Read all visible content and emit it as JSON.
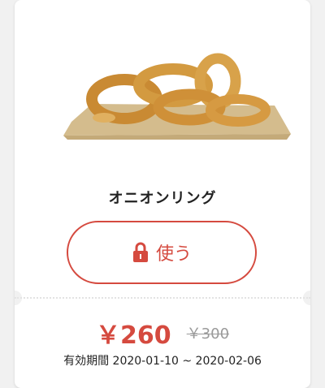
{
  "coupon": {
    "product_name": "オニオンリング",
    "use_button_label": "使う",
    "price": "￥260",
    "original_price": "￥300",
    "validity_label": "有効期間",
    "validity_range": "2020-01-10 ~ 2020-02-06"
  },
  "colors": {
    "accent": "#d54a3f",
    "background": "#f1f1f1"
  },
  "icons": {
    "lock": "lock-icon"
  }
}
